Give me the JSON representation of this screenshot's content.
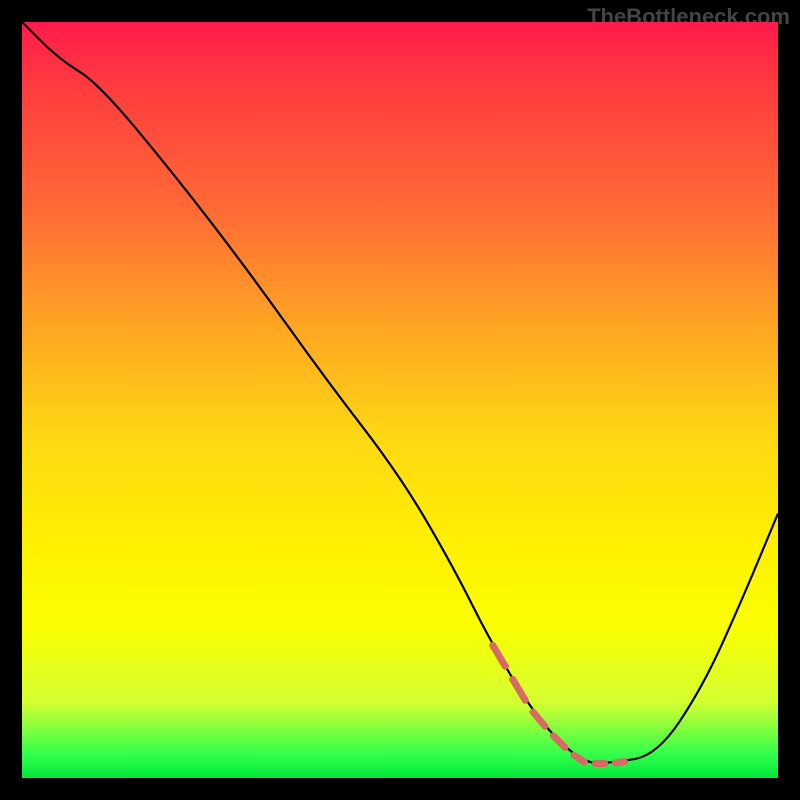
{
  "watermark": "TheBottleneck.com",
  "colors": {
    "page_bg": "#000000",
    "watermark": "#444444",
    "curve": "#000000",
    "highlight": "#d66b63",
    "gradient_top": "#ff1a4b",
    "gradient_bottom": "#00e83a"
  },
  "chart_data": {
    "type": "line",
    "title": "",
    "xlabel": "",
    "ylabel": "",
    "xlim": [
      0,
      100
    ],
    "ylim": [
      0,
      100
    ],
    "grid": false,
    "legend": false,
    "x": [
      0,
      5,
      10,
      20,
      30,
      40,
      50,
      57,
      62,
      68,
      74,
      78,
      84,
      90,
      95,
      100
    ],
    "values": [
      100,
      95,
      92,
      80,
      67,
      53,
      40,
      28,
      18,
      8,
      2,
      2,
      3,
      12,
      23,
      35
    ],
    "highlight_x_range": [
      62,
      78
    ],
    "annotations": []
  }
}
